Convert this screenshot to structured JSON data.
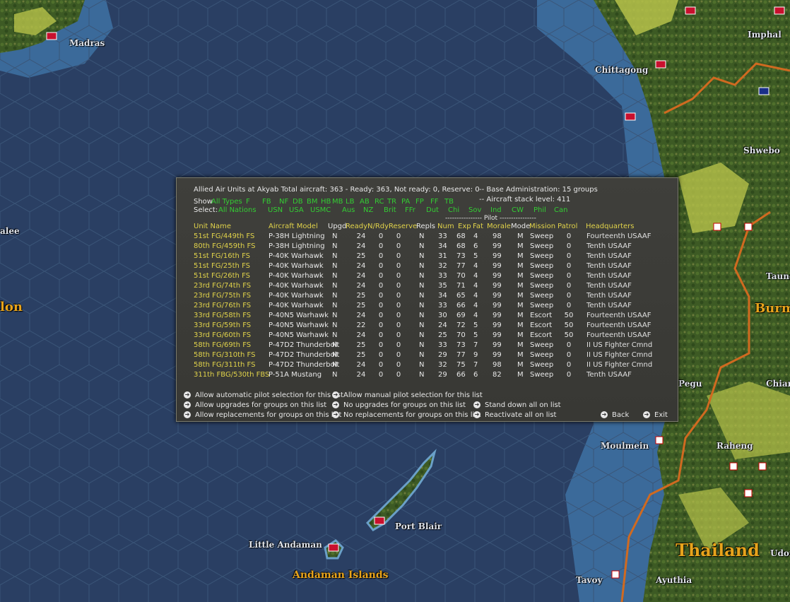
{
  "map": {
    "labels": {
      "madras": "Madras",
      "imphal": "Imphal",
      "chittagong": "Chittagong",
      "shwebo": "Shwebo",
      "akyab": "Akyab",
      "lon": "lon",
      "alee": "alee",
      "burm": "Burm",
      "taung": "Taung",
      "pegu": "Pegu",
      "chian": "Chian",
      "moulmein": "Moulmein",
      "raheng": "Raheng",
      "port_blair": "Port Blair",
      "little_andaman": "Little Andaman",
      "andaman_islands": "Andaman Islands",
      "thailand": "Thailand",
      "udor": "Udor",
      "tavoy": "Tavoy",
      "ayuthia": "Ayuthia"
    },
    "colors": {
      "ocean": "#2a3f63",
      "shallow": "#3f6f9f",
      "land": "#3c5a22",
      "border": "#d06a20"
    }
  },
  "panel": {
    "header_left": "Allied Air Units at Akyab  Total aircraft: 363 - Ready: 363, Not ready: 0, Reserve: 0",
    "header_right1": "-- Base Administration: 15 groups",
    "header_right2": "-- Aircraft stack level: 411",
    "show_label": "Show",
    "show_types": [
      "All Types",
      "F",
      "FB",
      "NF",
      "DB",
      "BM",
      "HB",
      "MB",
      "LB",
      "AB",
      "RC",
      "TR",
      "PA",
      "FP",
      "FF",
      "TB"
    ],
    "select_label": "Select:",
    "select_nations": [
      "All Nations",
      "USN",
      "USA",
      "USMC",
      "Aus",
      "NZ",
      "Brit",
      "FFr",
      "Dut",
      "Chi",
      "Sov",
      "Ind",
      "CW",
      "Phil",
      "Can"
    ],
    "pilot_header": "---------------- Pilot ----------------",
    "columns": {
      "unit": "Unit Name",
      "model": "Aircraft Model",
      "upgd": "Upgd",
      "ready": "Ready",
      "nrdy": "N/Rdy",
      "reserve": "Reserve",
      "repls": "Repls",
      "num": "Num",
      "exp": "Exp",
      "fat": "Fat",
      "morale": "Morale",
      "mode": "Mode",
      "mission": "Mission",
      "patrol": "Patrol",
      "hq": "Headquarters"
    },
    "rows": [
      [
        "51st FG/449th FS",
        "P-38H Lightning",
        "N",
        "24",
        "0",
        "0",
        "N",
        "33",
        "68",
        "4",
        "98",
        "M",
        "Sweep",
        "0",
        "Fourteenth USAAF"
      ],
      [
        "80th FG/459th FS",
        "P-38H Lightning",
        "N",
        "24",
        "0",
        "0",
        "N",
        "34",
        "68",
        "6",
        "99",
        "M",
        "Sweep",
        "0",
        "Tenth USAAF"
      ],
      [
        "51st FG/16th FS",
        "P-40K Warhawk",
        "N",
        "25",
        "0",
        "0",
        "N",
        "31",
        "73",
        "5",
        "99",
        "M",
        "Sweep",
        "0",
        "Tenth USAAF"
      ],
      [
        "51st FG/25th FS",
        "P-40K Warhawk",
        "N",
        "24",
        "0",
        "0",
        "N",
        "32",
        "77",
        "4",
        "99",
        "M",
        "Sweep",
        "0",
        "Tenth USAAF"
      ],
      [
        "51st FG/26th FS",
        "P-40K Warhawk",
        "N",
        "24",
        "0",
        "0",
        "N",
        "33",
        "70",
        "4",
        "99",
        "M",
        "Sweep",
        "0",
        "Tenth USAAF"
      ],
      [
        "23rd FG/74th FS",
        "P-40K Warhawk",
        "N",
        "24",
        "0",
        "0",
        "N",
        "35",
        "71",
        "4",
        "99",
        "M",
        "Sweep",
        "0",
        "Tenth USAAF"
      ],
      [
        "23rd FG/75th FS",
        "P-40K Warhawk",
        "N",
        "25",
        "0",
        "0",
        "N",
        "34",
        "65",
        "4",
        "99",
        "M",
        "Sweep",
        "0",
        "Tenth USAAF"
      ],
      [
        "23rd FG/76th FS",
        "P-40K Warhawk",
        "N",
        "25",
        "0",
        "0",
        "N",
        "33",
        "66",
        "4",
        "99",
        "M",
        "Sweep",
        "0",
        "Tenth USAAF"
      ],
      [
        "33rd FG/58th FS",
        "P-40N5 Warhawk",
        "N",
        "24",
        "0",
        "0",
        "N",
        "30",
        "69",
        "4",
        "99",
        "M",
        "Escort",
        "50",
        "Fourteenth USAAF"
      ],
      [
        "33rd FG/59th FS",
        "P-40N5 Warhawk",
        "N",
        "22",
        "0",
        "0",
        "N",
        "24",
        "72",
        "5",
        "99",
        "M",
        "Escort",
        "50",
        "Fourteenth USAAF"
      ],
      [
        "33rd FG/60th FS",
        "P-40N5 Warhawk",
        "N",
        "24",
        "0",
        "0",
        "N",
        "25",
        "70",
        "5",
        "99",
        "M",
        "Escort",
        "50",
        "Fourteenth USAAF"
      ],
      [
        "58th FG/69th FS",
        "P-47D2 Thunderbolt",
        "N",
        "25",
        "0",
        "0",
        "N",
        "33",
        "73",
        "7",
        "99",
        "M",
        "Sweep",
        "0",
        "II US Fighter Cmnd"
      ],
      [
        "58th FG/310th FS",
        "P-47D2 Thunderbolt",
        "N",
        "25",
        "0",
        "0",
        "N",
        "29",
        "77",
        "9",
        "99",
        "M",
        "Sweep",
        "0",
        "II US Fighter Cmnd"
      ],
      [
        "58th FG/311th FS",
        "P-47D2 Thunderbolt",
        "N",
        "24",
        "0",
        "0",
        "N",
        "32",
        "75",
        "7",
        "98",
        "M",
        "Sweep",
        "0",
        "II US Fighter Cmnd"
      ],
      [
        "311th FBG/530th FBS",
        "P-51A Mustang",
        "N",
        "24",
        "0",
        "0",
        "N",
        "29",
        "66",
        "6",
        "82",
        "M",
        "Sweep",
        "0",
        "Tenth USAAF"
      ]
    ],
    "actions": {
      "auto_pilot": "Allow automatic pilot selection for this list",
      "manual_pilot": "Allow manual pilot selection for this list",
      "allow_upgrades": "Allow upgrades for groups on this list",
      "no_upgrades": "No upgrades for groups on this list",
      "stand_down": "Stand down all on list",
      "allow_repl": "Allow replacements for groups on this list",
      "no_repl": "No replacements for groups on this list",
      "reactivate": "Reactivate all on list",
      "back": "Back",
      "exit": "Exit"
    }
  }
}
